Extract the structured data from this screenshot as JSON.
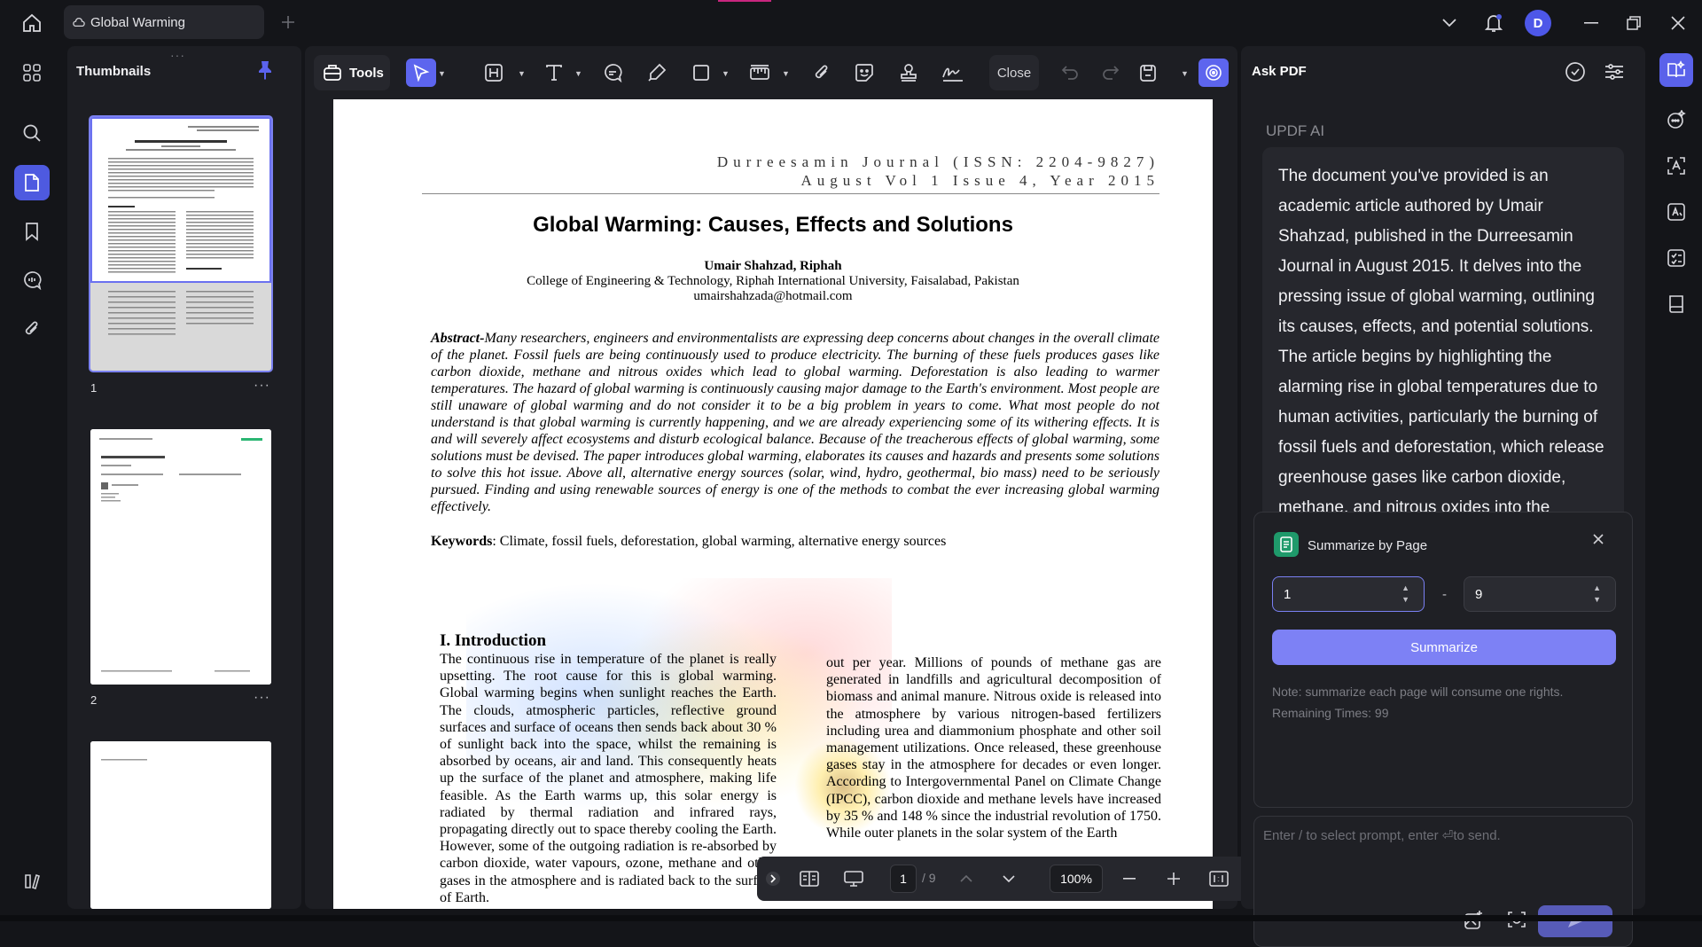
{
  "tab": {
    "title": "Global Warming"
  },
  "avatar": {
    "initial": "D"
  },
  "thumbnails": {
    "title": "Thumbnails",
    "pages": [
      {
        "num": "1",
        "more": "···"
      },
      {
        "num": "2",
        "more": "···"
      },
      {
        "num": "",
        "more": ""
      }
    ]
  },
  "toolbar": {
    "tools_label": "Tools",
    "close_label": "Close"
  },
  "document": {
    "journal_line1": "Durreesamin Journal (ISSN: 2204-9827)",
    "journal_line2": "August Vol 1 Issue 4, Year 2015",
    "title": "Global Warming: Causes, Effects and Solutions",
    "author": "Umair Shahzad, Riphah",
    "affiliation": "College of Engineering & Technology, Riphah International University, Faisalabad, Pakistan",
    "email": "umairshahzada@hotmail.com",
    "abstract_label": "Abstract-",
    "abstract_text": "Many researchers, engineers and environmentalists are expressing deep concerns about changes in the overall climate of the planet. Fossil fuels are being continuously used to produce electricity. The burning of these fuels produces gases like carbon dioxide, methane and nitrous oxides which lead to global warming. Deforestation is also leading to warmer temperatures. The hazard of global warming is continuously causing major damage to the Earth's environment. Most people are still unaware of global warming and do not consider it to be a big problem in years to come. What most people do not understand is that global warming is currently happening, and we are already experiencing some of its withering effects. It is and will severely affect ecosystems and disturb ecological balance. Because of the treacherous effects of global warming, some solutions must be devised. The paper introduces global warming, elaborates its causes and hazards and presents some solutions to solve this hot issue. Above all, alternative energy sources (solar, wind, hydro, geothermal, bio mass) need to be seriously pursued. Finding and using renewable sources of energy is one of the methods to combat the ever increasing global warming effectively.",
    "keywords_label": "Keywords",
    "keywords_text": ": Climate, fossil fuels, deforestation, global warming, alternative energy sources",
    "intro_heading": "I. Introduction",
    "intro_left": "The continuous rise in temperature of the planet is really upsetting. The root cause for this is global warming. Global warming begins when sunlight reaches the Earth. The clouds, atmospheric particles, reflective ground surfaces and surface of oceans then sends back about 30 % of sunlight back into the space, whilst the remaining is absorbed by oceans, air and land. This consequently heats up the surface of the planet and atmosphere, making life feasible. As the Earth warms up, this solar energy is radiated by thermal radiation and infrared rays, propagating directly out to space thereby cooling the Earth. However, some of the outgoing radiation is re-absorbed by carbon dioxide, water vapours, ozone, methane and other gases in the atmosphere and is radiated back to the surface of Earth.",
    "intro_right": "out per year. Millions of pounds of methane gas are generated in landfills and agricultural decomposition of biomass and animal manure. Nitrous oxide is released into the atmosphere by various nitrogen-based fertilizers including urea and diammonium phosphate and other soil management utilizations. Once released, these greenhouse gases stay in the atmosphere for decades or even longer. According to Intergovernmental Panel on Climate Change (IPCC), carbon dioxide and methane levels have increased by 35 % and 148 % since the industrial revolution of 1750. While outer planets in the solar system of the Earth"
  },
  "pagebar": {
    "current_page": "1",
    "total": "/ 9",
    "zoom": "100%"
  },
  "ai_panel": {
    "title": "Ask PDF",
    "label": "UPDF AI",
    "message": "The document you've provided is an academic article authored by Umair Shahzad, published in the Durreesamin Journal in August 2015. It delves into the pressing issue of global warming, outlining its causes, effects, and potential solutions. The article begins by highlighting the alarming rise in global temperatures due to human activities, particularly the burning of fossil fuels and deforestation, which release greenhouse gases like carbon dioxide, methane, and nitrous oxides into the",
    "summarize": {
      "title": "Summarize by Page",
      "from": "1",
      "dash": "-",
      "to": "9",
      "button": "Summarize",
      "note": "Note: summarize each page will consume one rights.",
      "remaining": "Remaining Times: 99"
    },
    "input_placeholder": "Enter / to select prompt, enter ⏎to send."
  },
  "colors": {
    "accent": "#5d65ee",
    "panel": "#1d1e23",
    "background": "#141519",
    "summarize_button": "#7d81f5"
  }
}
